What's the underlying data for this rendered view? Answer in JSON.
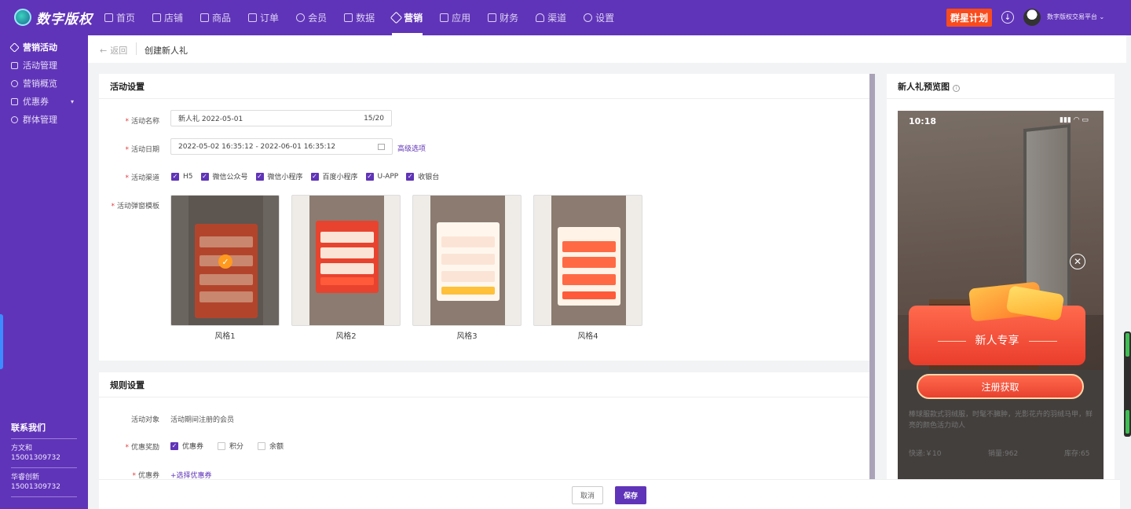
{
  "app": {
    "logo_text": "数字版权"
  },
  "nav": {
    "items": [
      "首页",
      "店铺",
      "商品",
      "订单",
      "会员",
      "数据",
      "营销",
      "应用",
      "财务",
      "渠道",
      "设置"
    ],
    "active": "营销",
    "plan_label": "群星计划",
    "user_name": "数字版权交易平台"
  },
  "sidebar": {
    "section": "营销活动",
    "items": [
      "活动管理",
      "营销概览",
      "优惠券",
      "群体管理"
    ],
    "contact_title": "联系我们",
    "contacts": [
      {
        "name": "方文和",
        "phone": "15001309732"
      },
      {
        "name": "华睿创新",
        "phone": "15001309732"
      }
    ]
  },
  "breadcrumb": {
    "back": "返回",
    "title": "创建新人礼"
  },
  "activity": {
    "section_title": "活动设置",
    "name_label": "活动名称",
    "name_value": "新人礼  2022-05-01",
    "name_count": "15/20",
    "date_label": "活动日期",
    "date_value": "2022-05-02 16:35:12 - 2022-06-01 16:35:12",
    "advanced_link": "高级选项",
    "channel_label": "活动渠道",
    "channels": [
      "H5",
      "微信公众号",
      "微信小程序",
      "百度小程序",
      "U-APP",
      "收银台"
    ],
    "template_label": "活动弹窗模板",
    "templates": [
      "风格1",
      "风格2",
      "风格3",
      "风格4"
    ]
  },
  "rules": {
    "section_title": "规则设置",
    "target_label": "活动对象",
    "target_value": "活动期间注册的会员",
    "reward_label": "优惠奖励",
    "rewards": [
      {
        "label": "优惠券",
        "checked": true
      },
      {
        "label": "积分",
        "checked": false
      },
      {
        "label": "余额",
        "checked": false
      }
    ],
    "coupon_label": "优惠券",
    "coupon_link": "+选择优惠券"
  },
  "footer": {
    "cancel": "取消",
    "save": "保存"
  },
  "preview": {
    "title": "新人礼预览图",
    "time": "10:18",
    "gift_title": "新人专享",
    "gift_button": "注册获取",
    "product_desc": "棒球服款式羽绒服，时髦不臃肿，光影花卉的羽绒马甲，鲜亮的颜色活力动人",
    "product_meta": [
      "快递:￥10",
      "销量:962",
      "库存:65"
    ]
  },
  "colors": {
    "brand": "#6034b8",
    "accent": "#fa4b1c"
  }
}
